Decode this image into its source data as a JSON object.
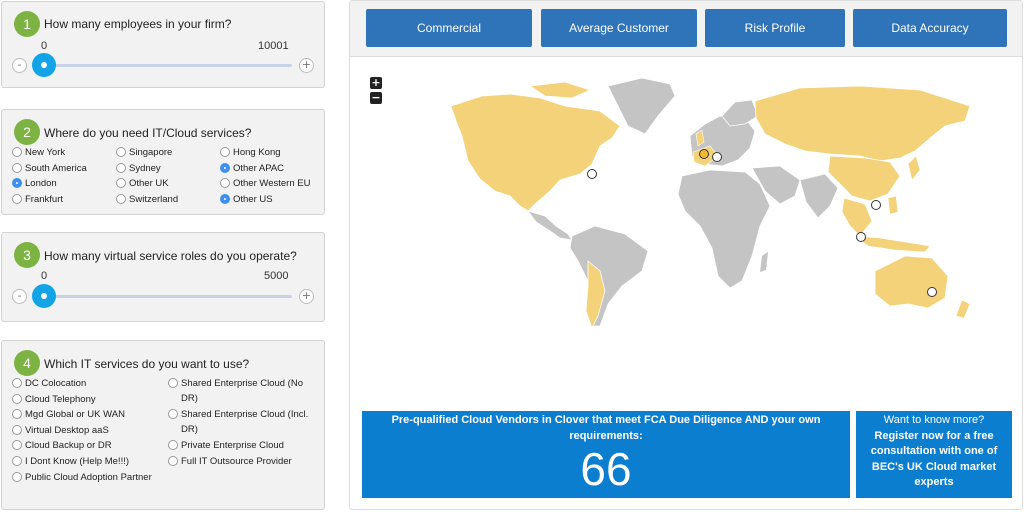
{
  "q1": {
    "number": "1",
    "text": "How many employees in your firm?",
    "min": "0",
    "max": "10001",
    "value_fraction": 0
  },
  "q2": {
    "number": "2",
    "text": "Where do you need IT/Cloud services?",
    "options": [
      {
        "label": "New York",
        "selected": false
      },
      {
        "label": "Singapore",
        "selected": false
      },
      {
        "label": "Hong Kong",
        "selected": false
      },
      {
        "label": "South America",
        "selected": false
      },
      {
        "label": "Sydney",
        "selected": false
      },
      {
        "label": "Other APAC",
        "selected": true
      },
      {
        "label": "London",
        "selected": true
      },
      {
        "label": "Other UK",
        "selected": false
      },
      {
        "label": "Other Western EU",
        "selected": false
      },
      {
        "label": "Frankfurt",
        "selected": false
      },
      {
        "label": "Switzerland",
        "selected": false
      },
      {
        "label": "Other US",
        "selected": true
      }
    ]
  },
  "q3": {
    "number": "3",
    "text": "How many virtual service roles do you operate?",
    "min": "0",
    "max": "5000",
    "value_fraction": 0
  },
  "q4": {
    "number": "4",
    "text": "Which IT services do you want to use?",
    "left_options": [
      {
        "label": "DC Colocation"
      },
      {
        "label": "Cloud Telephony"
      },
      {
        "label": "Mgd Global or UK WAN"
      },
      {
        "label": "Virtual Desktop aaS"
      },
      {
        "label": "Cloud Backup or DR"
      },
      {
        "label": "I Dont Know (Help Me!!!)"
      },
      {
        "label": "Public Cloud Adoption Partner"
      }
    ],
    "right_options": [
      {
        "label": "Shared Enterprise Cloud (No DR)"
      },
      {
        "label": "Shared Enterprise Cloud (Incl. DR)"
      },
      {
        "label": "Private Enterprise Cloud"
      },
      {
        "label": "Full IT Outsource Provider"
      }
    ]
  },
  "tabs": [
    "Commercial",
    "Average Customer",
    "Risk Profile",
    "Data Accuracy"
  ],
  "map": {
    "zoom_in": "+",
    "zoom_out": "−",
    "highlight_color": "#f3d27a",
    "base_color": "#c4c4c4",
    "marker_color": "#f5b82e"
  },
  "result": {
    "title": "Pre-qualified Cloud Vendors in Clover that meet FCA Due Diligence AND your own requirements:",
    "count": "66"
  },
  "cta": {
    "line1": "Want to know more?",
    "line2": "Register now for a free consultation with one of BEC's UK Cloud market experts"
  }
}
